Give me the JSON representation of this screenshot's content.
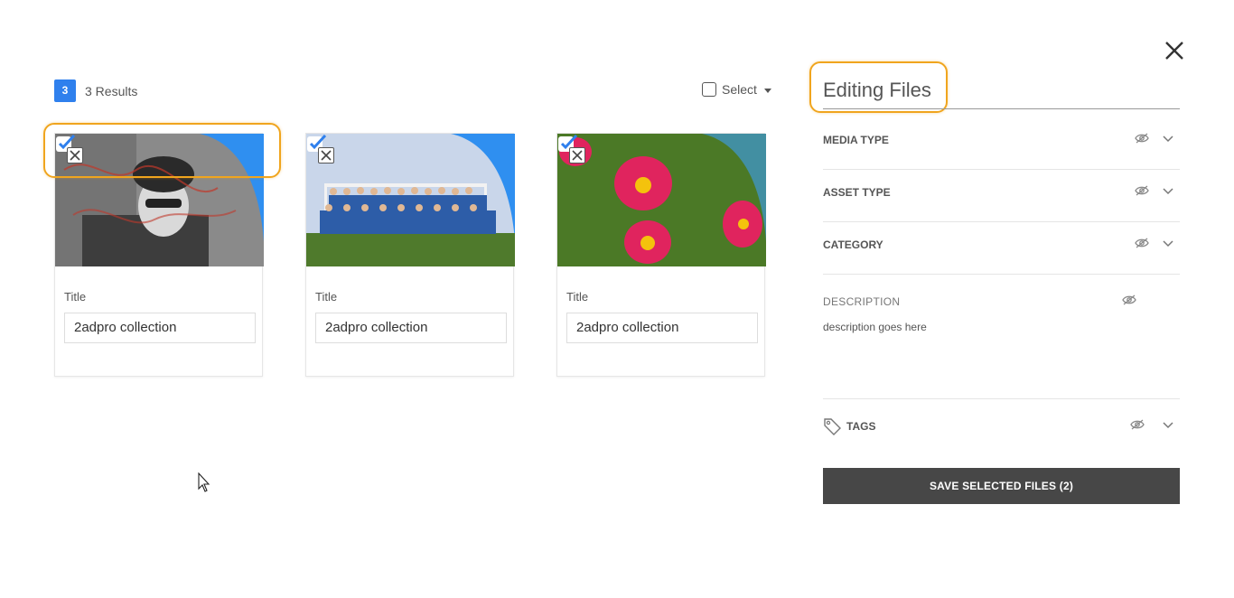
{
  "results": {
    "count_badge": "3",
    "label": "3 Results",
    "select_label": "Select"
  },
  "cards": [
    {
      "field_label": "Title",
      "title_value": "2adpro collection",
      "image": "woman-graffiti-photo",
      "selected": true
    },
    {
      "field_label": "Title",
      "title_value": "2adpro collection",
      "image": "team-photo",
      "selected": true
    },
    {
      "field_label": "Title",
      "title_value": "2adpro collection",
      "image": "flowers-photo",
      "selected": true
    }
  ],
  "panel": {
    "title": "Editing Files",
    "rows": [
      {
        "label": "MEDIA TYPE"
      },
      {
        "label": "ASSET TYPE"
      },
      {
        "label": "CATEGORY"
      }
    ],
    "description_label": "DESCRIPTION",
    "description_text": "description goes here",
    "tags_label": "TAGS",
    "save_label": "SAVE SELECTED FILES (2)"
  },
  "colors": {
    "accent_blue": "#2f80ed",
    "highlight_orange": "#f0a51e",
    "save_button": "#474747"
  },
  "icons": [
    "close-icon",
    "checkbox-icon",
    "caret-down-icon",
    "check-selected-icon",
    "remove-icon",
    "eye-icon",
    "chevron-down-icon",
    "tag-icon",
    "cursor-icon"
  ]
}
